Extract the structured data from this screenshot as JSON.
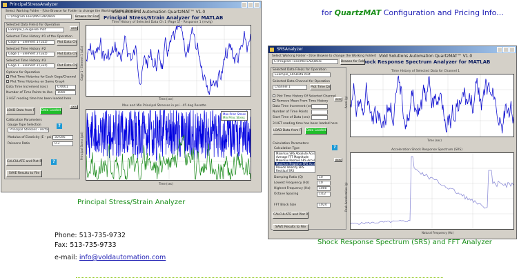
{
  "promo": {
    "prefix": "for ",
    "brand": "QuartzMAT",
    "suffix": " Configuration and Pricing Info..."
  },
  "captions": {
    "stress": "Principal Stress/Strain Analyzer",
    "srs": "Shock Response Spectrum (SRS) and FFT Analyzer"
  },
  "contact": {
    "phone": "Phone: 513-735-9732",
    "fax": "Fax: 513-735-9733",
    "email_label": "e-mail: ",
    "email": "info@voldautomation.com"
  },
  "win1": {
    "title": "PrincipalStressAnalyzer",
    "company": "Vold Solutions Automation   QuartzMAT™  V1.0",
    "app_title": "Principal Stress/Strain Analyzer for MATLAB",
    "select_file_label": "Select Working Folder - [Use Browse for Folder to change the Working Folder Selection]",
    "file_path": "C:\\Program Files\\MATLAB\\Work",
    "browse_button": "Browse for Folder",
    "data_file_label": "Selected Data File(s) for Operation",
    "data_file": "Example_GaugeFile.mat",
    "ch1_label": "Selected Time History #1 of the Operation",
    "ch1_value": "Gage 1 - Element 1 (uEz)",
    "ch2_label": "Selected Time History #2",
    "ch2_value": "Gage 1 - Element 2 (uEz)",
    "ch3_label": "Selected Time History #3",
    "ch3_value": "Gage 1 - Element 3 (uEz)",
    "plot_btn1": "Plot Data Ch 1",
    "plot_btn2": "Plot Data Ch 2",
    "plot_btn3": "Plot Data Ch 3",
    "opts_label": "Options for Operation",
    "opt1": "Plot Time Histories for Each Gage/Channel",
    "opt2": "Plot Time Histories on Same Graph",
    "param1_label": "Data Time Increment (sec)",
    "param1_value": "0.0001",
    "param2_label": "Number of Time Points to Use",
    "param2_value": "1000",
    "note": "3 HGT reading time has been loaded here",
    "load_button": "LOAD Data from File",
    "status_button": "Data Loaded",
    "cal_label": "Calibration Parameters",
    "gauge_type_label": "Gauge Type Selection",
    "gauge_type": "Principal Stresses - rectangular",
    "modulus_label": "Modulus of Elasticity (E - psi)",
    "modulus_value": "30.0e6",
    "poisson_label": "Poissons Ratio",
    "poisson_value": "0.3",
    "calc_button": "CALCULATE and Plot Results",
    "save_button": "SAVE Results to File",
    "plot1_title": "Time History of Selected Data Ch 1 (Page 1) - Response 1 (mv/g)",
    "plot1_ylabel": "Gage 1 - Element 1 (uEz)",
    "plot1_xlabel": "Time (sec)",
    "plot2_title": "Max and Min Principal Stresses in psi - 45 deg Rosette",
    "plot2_ylabel": "Principal Stress (psi)",
    "plot2_xlabel": "Time (sec)",
    "legend1": "Max Princ Stress",
    "legend2": "Min Princ Stress",
    "small_btn": "AXIS"
  },
  "win2": {
    "title": "SRSAnalyzer",
    "company": "Vold Solutions Automation   QuartzMAT™  V1.0",
    "app_title": "Shock Response Spectrum Analyzer for MATLAB",
    "select_file_label": "Select Working Folder - [Use Browse to change the Working Folder]",
    "file_path": "C:\\Program Files\\MATLAB\\Work",
    "browse_button": "Browse for Folder",
    "data_file_label": "Selected Data File(s) for Operation",
    "data_file": "Example_SRSData.mat",
    "ch_label": "Selected Data Channel for Operation",
    "ch_value": "Channel 1",
    "plot_btn": "Plot Time Data",
    "opt1": "Plot Time History Of Selected Channel",
    "opt2": "Remove Mean From Time History",
    "param1_label": "Data Time Increment (sec)",
    "param2_label": "Number of Time Points",
    "param3_label": "Start Time of Data (sec)",
    "note": "3 HGT reading time has been loaded here",
    "load_button": "LOAD Data from File",
    "status_button": "Data Loaded",
    "params_label": "Calculation Parameters",
    "analysis_label": "Calculation Type",
    "analysis_options": [
      "Maximax SRS Absolute Acceleration",
      "Average FFT Magnitude",
      "Maximax Positive SRS Accel",
      "Maximax Negative SRS Accel",
      "Pseudo Velocity SRS",
      "Residual SRS"
    ],
    "selected_option_index": 3,
    "p1_label": "Damping Ratio (Q)",
    "p1_value": "10",
    "p2_label": "Lowest Frequency (Hz)",
    "p2_value": "10",
    "p3_label": "Highest Frequency (Hz)",
    "p3_value": "1000",
    "p4_label": "Octave Spacing",
    "p4_value": "1/12",
    "p5_label": "FFT Block Size",
    "p5_value": "1024",
    "calc_button": "CALCULATE and Plot Results",
    "save_button": "SAVE Results to File",
    "plot1_title": "Time History of Selected Data for Channel 1",
    "plot1_ylabel": "Accel (g)",
    "plot1_xlabel": "Time (sec)",
    "plot2_title": "Acceleration Shock Response Spectrum (SRS)",
    "plot2_ylabel": "Peak Acceleration (g)",
    "plot2_xlabel": "Natural Frequency (Hz)",
    "small_btn": "AXIS"
  }
}
